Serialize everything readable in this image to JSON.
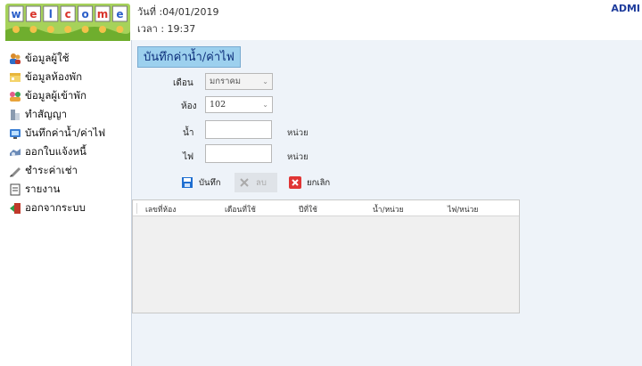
{
  "header": {
    "logo_letters": [
      "w",
      "e",
      "l",
      "c",
      "o",
      "m",
      "e"
    ],
    "date_text": "วันที่ :04/01/2019",
    "time_text": "เวลา : 19:37",
    "user_text": "ADMI"
  },
  "sidebar": {
    "items": [
      {
        "label": "ข้อมูลผู้ใช้",
        "icon": "users-icon"
      },
      {
        "label": "ข้อมูลห้องพัก",
        "icon": "room-icon"
      },
      {
        "label": "ข้อมูลผู้เข้าพัก",
        "icon": "guests-icon"
      },
      {
        "label": "ทำสัญญา",
        "icon": "contract-icon"
      },
      {
        "label": "บันทึกค่าน้ำ/ค่าไฟ",
        "icon": "meter-icon"
      },
      {
        "label": "ออกใบแจ้งหนี้",
        "icon": "invoice-icon"
      },
      {
        "label": "ชำระค่าเช่า",
        "icon": "payment-icon"
      },
      {
        "label": "รายงาน",
        "icon": "report-icon"
      },
      {
        "label": "ออกจากระบบ",
        "icon": "logout-icon"
      }
    ]
  },
  "form": {
    "title": "บันทึกค่าน้ำ/ค่าไฟ",
    "month_label": "เดือน",
    "month_value": "มกราคม",
    "room_label": "ห้อง",
    "room_value": "102",
    "water_label": "น้ำ",
    "water_value": "",
    "water_unit": "หน่วย",
    "electric_label": "ไฟ",
    "electric_value": "",
    "electric_unit": "หน่วย",
    "save_label": "บันทึก",
    "delete_label": "ลบ",
    "cancel_label": "ยกเลิก"
  },
  "table": {
    "columns": [
      "เลขที่ห้อง",
      "เดือนที่ใช้",
      "ปีที่ใช้",
      "น้ำ/หน่วย",
      "ไฟ/หน่วย"
    ]
  },
  "colors": {
    "title_bg": "#9cd0ee",
    "panel_bg": "#eef3f9",
    "accent": "#1e3c9c"
  }
}
